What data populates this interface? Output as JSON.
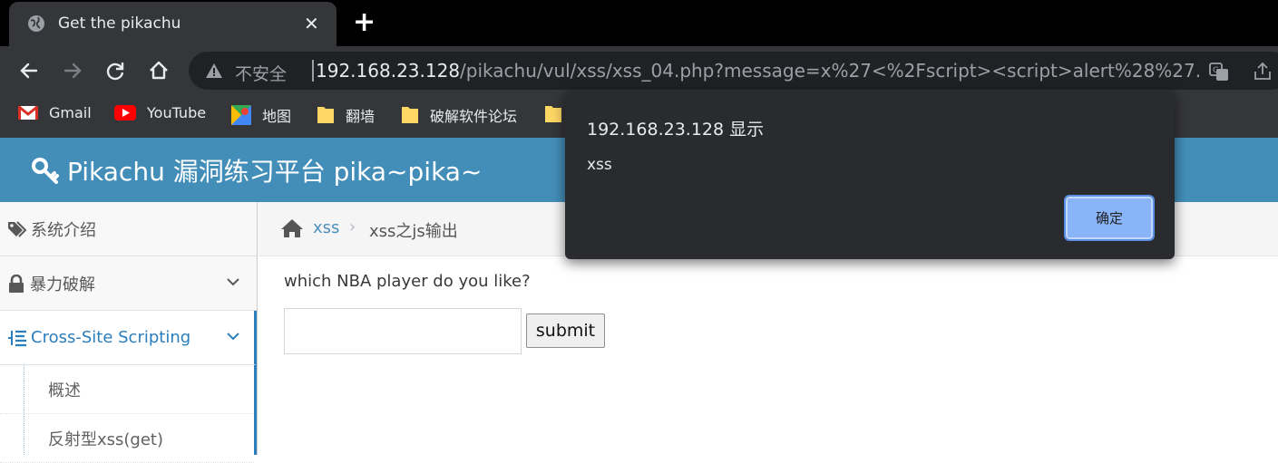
{
  "browser": {
    "tab_title": "Get the pikachu",
    "insecure_label": "不安全",
    "url_host": "192.168.23.128",
    "url_path": "/pikachu/vul/xss/xss_04.php?message=x%27<%2Fscript><script>alert%28%27...",
    "bookmarks": [
      {
        "label": "Gmail",
        "icon": "gmail-icon"
      },
      {
        "label": "YouTube",
        "icon": "youtube-icon"
      },
      {
        "label": "地图",
        "icon": "maps-icon"
      },
      {
        "label": "翻墙",
        "icon": "folder-icon"
      },
      {
        "label": "破解软件论坛",
        "icon": "folder-icon"
      }
    ]
  },
  "header": {
    "brand": "Pikachu 漏洞练习平台 pika~pika~",
    "brand_color": "#438eb9"
  },
  "sidebar": {
    "items": [
      {
        "label": "系统介绍",
        "icon": "tags-icon"
      },
      {
        "label": "暴力破解",
        "icon": "lock-icon"
      },
      {
        "label": "Cross-Site Scripting",
        "icon": "list-icon",
        "active": true
      }
    ],
    "subitems": [
      "概述",
      "反射型xss(get)"
    ]
  },
  "breadcrumb": {
    "section": "xss",
    "current": "xss之js输出"
  },
  "main": {
    "question": "which NBA player do you like?",
    "input_value": "",
    "submit_label": "submit"
  },
  "dialog": {
    "title": "192.168.23.128 显示",
    "message": "xss",
    "ok_label": "确定"
  }
}
